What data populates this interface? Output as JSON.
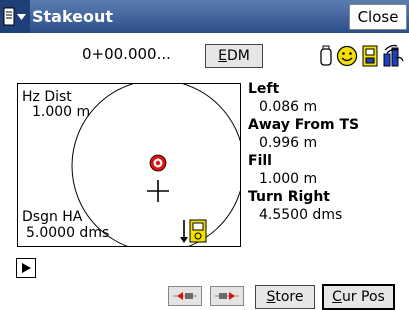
{
  "titlebar": {
    "title": "Stakeout",
    "close_label": "Close"
  },
  "header": {
    "station": "0+00.000...",
    "edm_label": "EDM"
  },
  "plot": {
    "hz_dist_label": "Hz Dist",
    "hz_dist_value": "1.000 m",
    "dsgn_ha_label": "Dsgn HA",
    "dsgn_ha_value": "5.0000 dms"
  },
  "readouts": [
    {
      "label": "Left",
      "value": "0.086 m"
    },
    {
      "label": "Away From TS",
      "value": "0.996 m"
    },
    {
      "label": "Fill",
      "value": "1.000 m"
    },
    {
      "label": "Turn Right",
      "value": "4.5500 dms"
    }
  ],
  "footer": {
    "store_label": "Store",
    "curpos_label": "Cur Pos"
  },
  "colors": {
    "title_bar": "#3a5f99",
    "target_red": "#e01010",
    "icon_yellow": "#f5e000",
    "icon_blue": "#2040c0"
  },
  "icons": [
    "start-menu-icon",
    "battery-icon",
    "smiley-icon",
    "instrument-status-icon",
    "radio-link-icon",
    "play-icon",
    "left-arrow-icon",
    "right-arrow-icon",
    "total-station-icon",
    "target-icon",
    "crosshair-icon"
  ]
}
